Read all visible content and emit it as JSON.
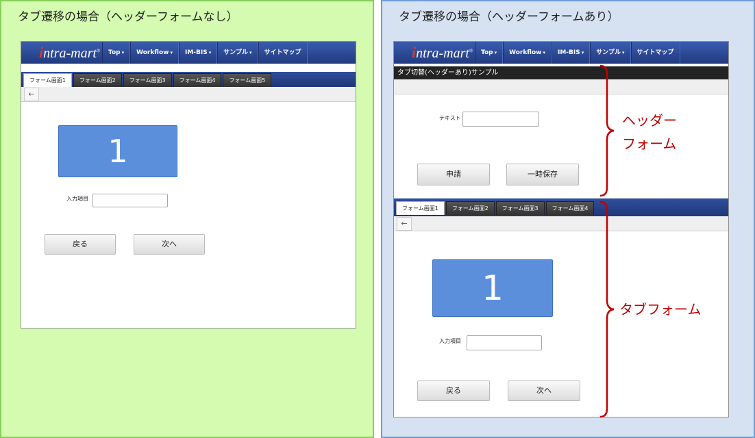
{
  "left": {
    "title": "タブ遷移の場合（ヘッダーフォームなし）",
    "logo": {
      "mark": "i",
      "text": "ntra-mart",
      "reg": "®"
    },
    "nav": [
      {
        "label": "Top",
        "caret": "▾"
      },
      {
        "label": "Workflow",
        "caret": "▾"
      },
      {
        "label": "IM-BIS",
        "caret": "▾"
      },
      {
        "label": "サンプル",
        "caret": "▾"
      },
      {
        "label": "サイトマップ",
        "caret": ""
      }
    ],
    "tabs": [
      "フォーム画面1",
      "フォーム画面2",
      "フォーム画面3",
      "フォーム画面4",
      "フォーム画面5"
    ],
    "back_icon": "←",
    "box_number": "1",
    "field_label": "入力項目",
    "field_value": "",
    "back_button": "戻る",
    "next_button": "次へ"
  },
  "right": {
    "title": "タブ遷移の場合（ヘッダーフォームあり）",
    "logo": {
      "mark": "i",
      "text": "ntra-mart",
      "reg": "®"
    },
    "nav": [
      {
        "label": "Top",
        "caret": "▾"
      },
      {
        "label": "Workflow",
        "caret": "▾"
      },
      {
        "label": "IM-BIS",
        "caret": "▾"
      },
      {
        "label": "サンプル",
        "caret": "▾"
      },
      {
        "label": "サイトマップ",
        "caret": ""
      }
    ],
    "header_title": "タブ切替(ヘッダーあり)サンプル",
    "text_label": "テキスト",
    "text_value": "",
    "apply_button": "申請",
    "save_button": "一時保存",
    "tabs": [
      "フォーム画面1",
      "フォーム画面2",
      "フォーム画面3",
      "フォーム画面4"
    ],
    "back_icon": "←",
    "box_number": "1",
    "field_label": "入力項目",
    "field_value": "",
    "back_button": "戻る",
    "next_button": "次へ"
  },
  "annotations": {
    "header_form_line1": "ヘッダー",
    "header_form_line2": "フォーム",
    "tab_form": "タブフォーム",
    "color": "#c00000"
  },
  "colors": {
    "left_bg": "#d4fbb0",
    "right_bg": "#d6e2f2",
    "navbar": "#2a4590",
    "box": "#5b8fdc"
  }
}
